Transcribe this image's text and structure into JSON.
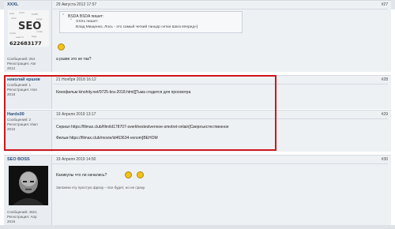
{
  "posts": [
    {
      "username": "XXXL",
      "info": [
        "Сообщений: 264",
        "Регистрация: Авг",
        "2012"
      ],
      "date": "29 Августа 2012 17:57",
      "number": "#27",
      "quote": {
        "header": "BSDA BSDA пишет:",
        "inner_author": "XXXL пишет:",
        "inner_text": "Влад Мищенко, Лось - это самый четкий танцор сетки Шага вперед»]"
      },
      "message": "а разве это не так?",
      "avatar_text": "SEO",
      "avatar_number": "622683177"
    },
    {
      "username": "николай ершов",
      "info": [
        "Сообщений: 1",
        "Регистрация: Ноя",
        "2018"
      ],
      "date": "21 Ноября 2018 16:12",
      "number": "#28",
      "message": "Кинофильм kinohity.net/9725-bra-2018.html[[Тьма сгодится для просмотра"
    },
    {
      "username": "Hards00",
      "info": [
        "Сообщений: 2",
        "Регистрация: Июл",
        "2010"
      ],
      "date": "19 Апреля 2019 13:17",
      "number": "#29",
      "message_1": "Сериал  https://filmax.club/film/id178707-sverkhestestvennoe-smotret-onlain]Сверхъестественное",
      "message_2": "Фильм  https://filmax.club/movie/id463634-venom]ВЕНОМ"
    },
    {
      "username": "SEO BOSS",
      "info": [
        "Сообщений: 4621",
        "Регистрация: Апр",
        "2016"
      ],
      "date": "19 Апреля 2019 14:50",
      "number": "#30",
      "message_1": "Каникулы что ли начались?",
      "message_2": "Запомни эту простую фразу – все будет, но не сразу."
    }
  ]
}
